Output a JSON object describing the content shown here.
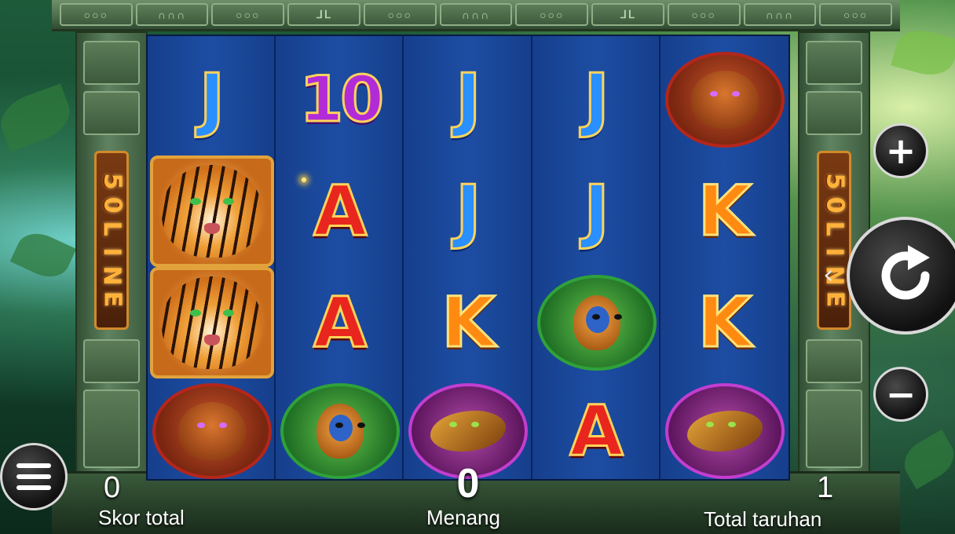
{
  "frame": {
    "badge_text": "50 LINE"
  },
  "reels": [
    {
      "symbols": [
        "J",
        "tiger",
        "tiger",
        "bear"
      ]
    },
    {
      "symbols": [
        "10",
        "A",
        "A",
        "monkey"
      ]
    },
    {
      "symbols": [
        "J",
        "J",
        "K",
        "snake"
      ]
    },
    {
      "symbols": [
        "J",
        "J",
        "monkey",
        "A"
      ]
    },
    {
      "symbols": [
        "bear",
        "K",
        "K",
        "snake"
      ]
    }
  ],
  "controls": {
    "plus_label": "+",
    "minus_label": "−",
    "spin_icon": "refresh-icon",
    "menu_icon": "hamburger-icon"
  },
  "info": {
    "total_score_value": "0",
    "total_score_label": "Skor total",
    "win_value": "0",
    "win_label": "Menang",
    "total_bet_value": "1",
    "total_bet_label": "Total taruhan"
  },
  "colors": {
    "reel_bg": "#1d4da3",
    "frame_stone": "#4b6b4a",
    "J": "#2a8fff",
    "10": "#b12bd8",
    "A": "#e8261d",
    "K": "#ff8a12"
  }
}
